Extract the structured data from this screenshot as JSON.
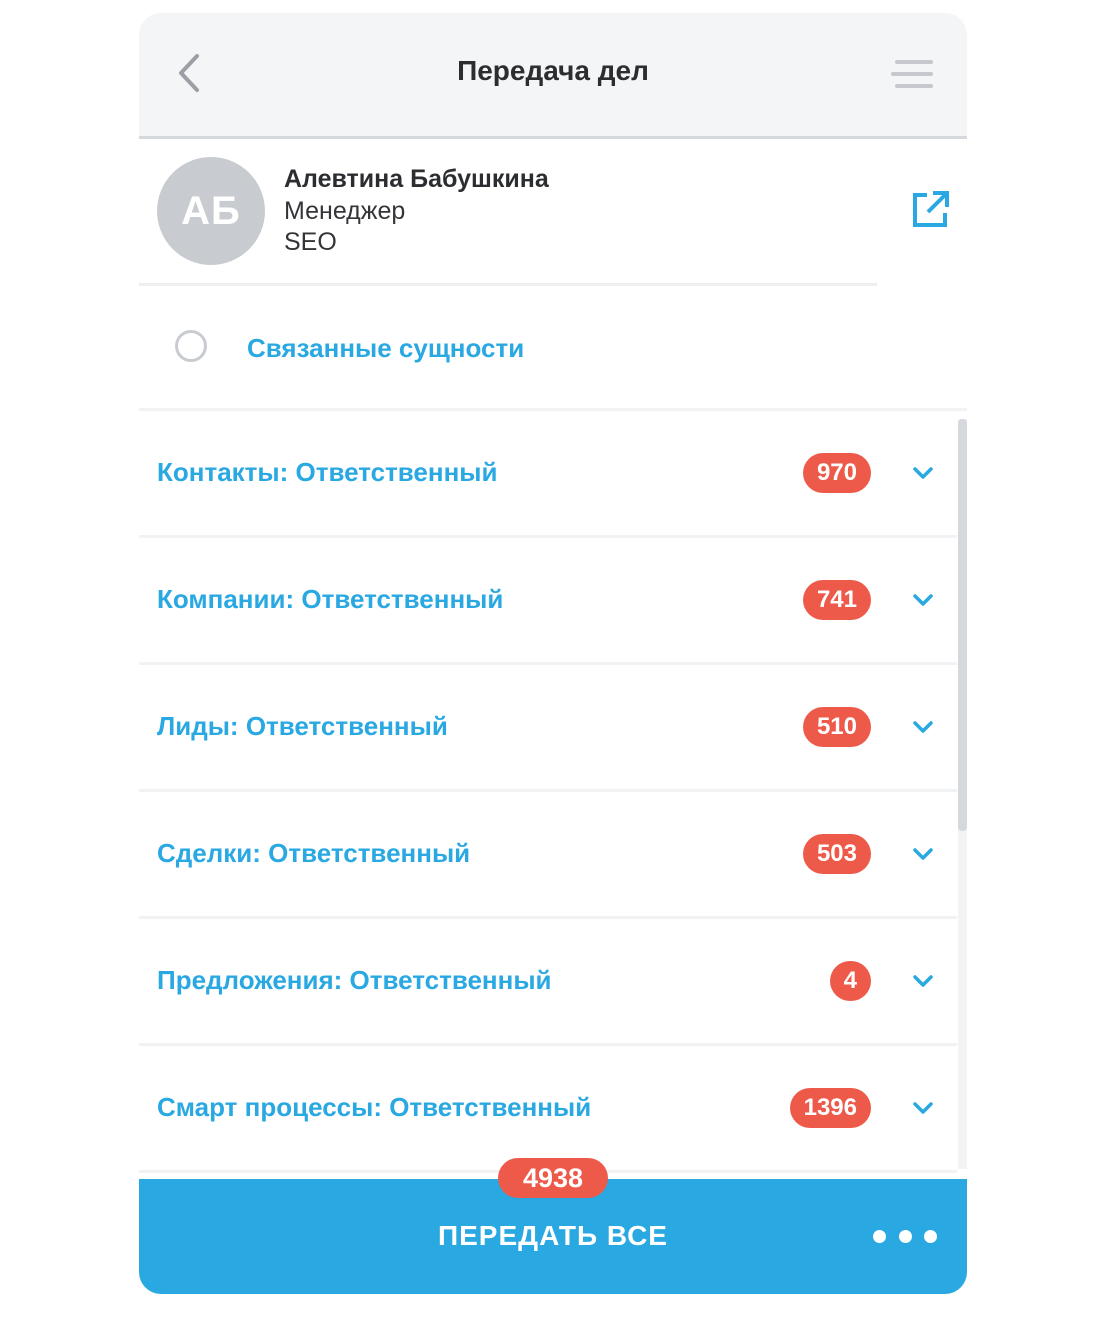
{
  "header": {
    "title": "Передача дел",
    "back_icon": "chevron-left-icon",
    "menu_icon": "hamburger-menu-icon"
  },
  "user": {
    "initials": "АБ",
    "name": "Алевтина Бабушкина",
    "role": "Менеджер",
    "department": "SEO",
    "open_icon": "external-link-icon"
  },
  "related": {
    "label": "Связанные сущности",
    "checked": false
  },
  "entities": [
    {
      "label": "Контакты: Ответственный",
      "count": "970"
    },
    {
      "label": "Компании: Ответственный",
      "count": "741"
    },
    {
      "label": "Лиды: Ответственный",
      "count": "510"
    },
    {
      "label": "Сделки: Ответственный",
      "count": "503"
    },
    {
      "label": "Предложения: Ответственный",
      "count": "4"
    },
    {
      "label": "Смарт процессы: Ответственный",
      "count": "1396"
    }
  ],
  "footer": {
    "total": "4938",
    "action_label": "ПЕРЕДАТЬ ВСЕ",
    "more_icon": "more-dots-icon"
  },
  "colors": {
    "accent": "#29a8e1",
    "badge": "#ee5a4a",
    "link": "#2aa8e2"
  }
}
